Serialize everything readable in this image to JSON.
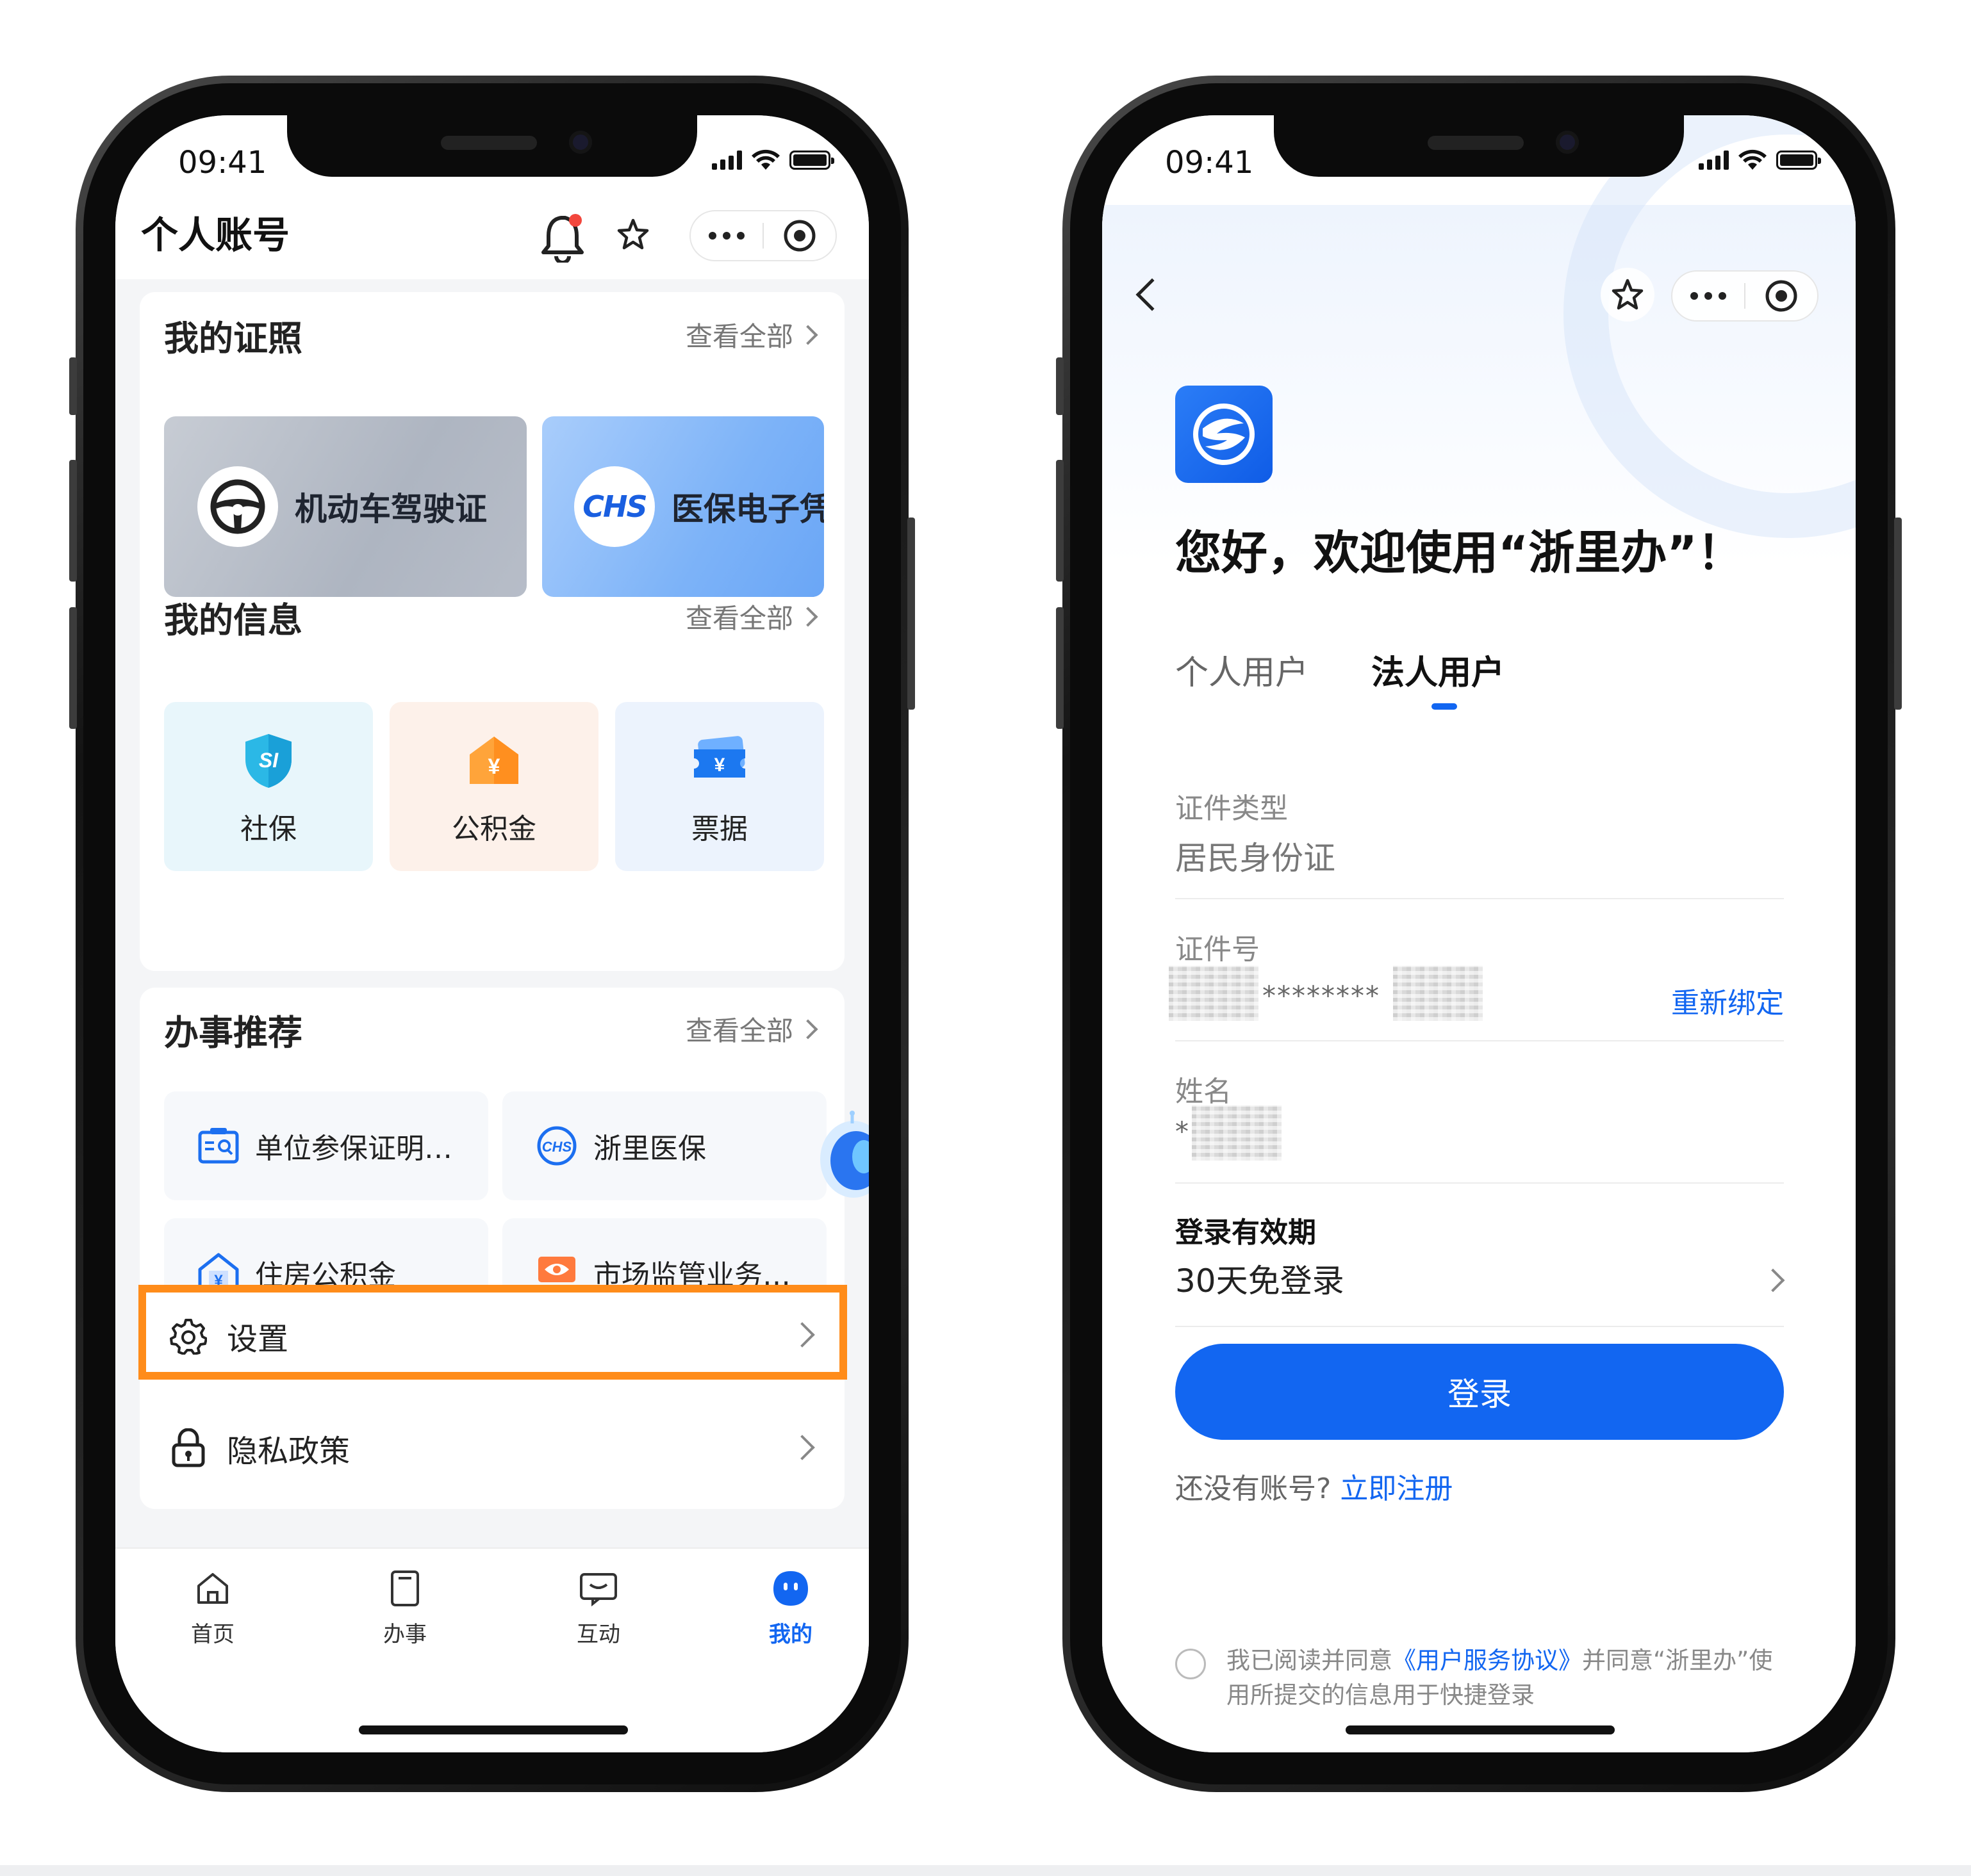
{
  "status": {
    "time": "09:41"
  },
  "left": {
    "title": "个人账号",
    "licenses": {
      "title": "我的证照",
      "see_all": "查看全部",
      "items": [
        {
          "label": "机动车驾驶证",
          "icon": "steering-wheel-icon"
        },
        {
          "label": "医保电子凭",
          "icon": "chs-logo-icon",
          "icon_text": "CHS"
        }
      ]
    },
    "info": {
      "title": "我的信息",
      "see_all": "查看全部",
      "items": [
        {
          "label": "社保",
          "icon": "shield-si-icon",
          "icon_text": "SI",
          "bg": "#e8f6fb"
        },
        {
          "label": "公积金",
          "icon": "house-yuan-icon",
          "icon_text": "¥",
          "bg": "#fdf1ea"
        },
        {
          "label": "票据",
          "icon": "ticket-yuan-icon",
          "icon_text": "¥",
          "bg": "#ecf3fd"
        }
      ]
    },
    "recommend": {
      "title": "办事推荐",
      "see_all": "查看全部",
      "items": [
        {
          "label": "单位参保证明…",
          "icon": "id-card-icon"
        },
        {
          "label": "浙里医保",
          "icon": "chs-badge-icon",
          "icon_text": "CHS"
        },
        {
          "label": "住房公积金",
          "icon": "house-fund-icon",
          "icon_text": "¥"
        },
        {
          "label": "市场监管业务…",
          "icon": "monitor-eye-icon"
        }
      ]
    },
    "list": [
      {
        "label": "设置",
        "icon": "gear-icon"
      },
      {
        "label": "隐私政策",
        "icon": "lock-icon"
      }
    ],
    "tabs": [
      {
        "label": "首页",
        "icon": "home-icon"
      },
      {
        "label": "办事",
        "icon": "document-icon"
      },
      {
        "label": "互动",
        "icon": "message-icon"
      },
      {
        "label": "我的",
        "icon": "user-face-icon",
        "active": true
      }
    ]
  },
  "right": {
    "welcome": "您好，欢迎使用“浙里办”！",
    "user_tabs": [
      {
        "label": "个人用户"
      },
      {
        "label": "法人用户",
        "active": true
      }
    ],
    "fields": {
      "id_type_label": "证件类型",
      "id_type_value": "居民身份证",
      "id_no_label": "证件号",
      "id_no_mask": "********",
      "rebind": "重新绑定",
      "name_label": "姓名",
      "name_mask": "*",
      "validity_label": "登录有效期",
      "validity_value": "30天免登录"
    },
    "login_button": "登录",
    "register_prompt": "还没有账号?",
    "register_link": "立即注册",
    "agreement": {
      "pre": "我已阅读并同意",
      "link": "《用户服务协议》",
      "post": "并同意“浙里办”使用所提交的信息用于快捷登录"
    }
  },
  "colors": {
    "accent": "#1266f1",
    "highlight": "#ff8c1a"
  }
}
